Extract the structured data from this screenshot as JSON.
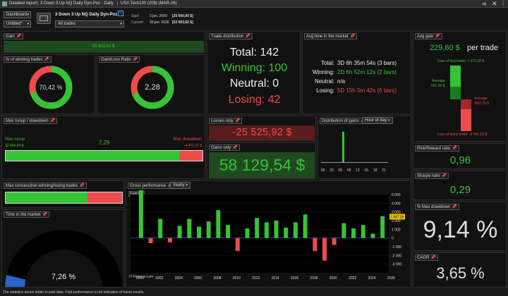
{
  "titlebar": {
    "tab1": "Detailed report",
    "tab2": "3 Down  3 Up NQ Daily Dyn-Poz - Daily",
    "tab3": "USA Tech100 (20$) (MAR-26)"
  },
  "toolbar": {
    "dashboard": "Dashboard",
    "untitled": "Untitled*",
    "strategy": "3 Down  3 Up NQ Daily Dyn-Poz",
    "filter": "All trades",
    "start_label": "Start:",
    "start_date": "3 jan. 2000",
    "start_value": "[20 000,00 $]",
    "current_label": "Current:",
    "current_date": "30 jan. 2026",
    "current_value": "[52 603,62 $]"
  },
  "gain": {
    "title": "Gain",
    "value": "32 603,62 $"
  },
  "winning_pct": {
    "title": "% of winning trades",
    "value": "70,42 %",
    "fraction": 0.7042
  },
  "gain_loss": {
    "title": "Gain/Loss Ratio",
    "value": "2,28",
    "fraction": 0.695
  },
  "trade_dist": {
    "title": "Trade distribution",
    "total": "Total: 142",
    "winning": "Winning: 100",
    "neutral": "Neutral: 0",
    "losing": "Losing: 42"
  },
  "avg_time": {
    "title": "Avg time in the market",
    "total_label": "Total:",
    "total": "3D 6h 35m 54s (3 bars)",
    "winning_label": "Winning:",
    "winning": "2D 6h 52m 12s (2 bars)",
    "neutral_label": "Neutral:",
    "neutral": "n/a",
    "losing_label": "Losing:",
    "losing": "5D 15h 5m 42s (6 bars)"
  },
  "avg_gain": {
    "title": "Avg gain",
    "value": "229,60 $",
    "per_trade": "per trade",
    "best_label": "Gain of best trade: 1 870,20 $",
    "average_label": "Average",
    "average_value": "581,30 $",
    "loss_avg_label": "Average",
    "loss_avg_value": "-807,76 $",
    "worst_label": "Loss of worst trade: -2 691,52 $"
  },
  "runup": {
    "title": "Max runup / drawdown",
    "runup_label": "Max runup",
    "runup_value": "32 606,04 $",
    "ratio": "7,29",
    "drawdown_label": "Max drawdown",
    "drawdown_value": "-4 471,12 $",
    "runup_fraction": 0.88
  },
  "losses_only": {
    "title": "Losses only",
    "value": "-25 525,92 $"
  },
  "gains_only": {
    "title": "Gains only",
    "value": "58 129,54 $"
  },
  "dist_gains": {
    "title": "Distribution of gains",
    "mode": "Hour of day",
    "ticks": [
      "00",
      "03",
      "06",
      "09",
      "12",
      "15",
      "18",
      "21"
    ]
  },
  "risk_reward": {
    "title": "Risk/Reward ratio",
    "value": "0,96"
  },
  "sharpe": {
    "title": "Sharpe ratio",
    "value": "0,29"
  },
  "max_dd_pct": {
    "title": "% Max drawdown",
    "value": "9,14 %"
  },
  "cagr": {
    "title": "CAGR",
    "value": "3,65 %"
  },
  "consec": {
    "title": "Max consecutive winning/losing trades",
    "win_fraction": 0.7
  },
  "time_market": {
    "title": "Time in the market",
    "value": "7,26 %",
    "fraction": 0.0726
  },
  "gross": {
    "title": "Gross performance",
    "mode": "Yearly",
    "gains_label": "Gains: $",
    "watermark": "IT-Finance.com",
    "current_marker": "2 447,26"
  },
  "chart_data": {
    "type": "bar",
    "title": "Gross performance",
    "ylabel": "Gains: $",
    "ylim": [
      -4000,
      5000
    ],
    "y_ticks": [
      "5 000",
      "4 000",
      "3 000",
      "2 000",
      "1 000",
      "0",
      "-1 000",
      "-2 000",
      "-3 000"
    ],
    "x_ticks": [
      "2000",
      "2002",
      "2004",
      "2006",
      "2008",
      "2010",
      "2012",
      "2014",
      "2016",
      "2018",
      "2020",
      "2022",
      "2024",
      "2026"
    ],
    "categories": [
      "2000",
      "2001",
      "2002",
      "2003",
      "2004",
      "2005",
      "2006",
      "2007",
      "2008",
      "2009",
      "2010",
      "2011",
      "2012",
      "2013",
      "2014",
      "2015",
      "2016",
      "2017",
      "2018",
      "2019",
      "2020",
      "2021",
      "2022",
      "2023",
      "2024",
      "2025"
    ],
    "values": [
      5800,
      -600,
      2200,
      -500,
      1400,
      2200,
      1300,
      1900,
      3200,
      1500,
      -1500,
      1100,
      2300,
      1800,
      2000,
      1200,
      1800,
      2700,
      -1500,
      -2600,
      -800,
      1700,
      1100,
      1500,
      500,
      2500
    ]
  },
  "footer": {
    "text": "The statistics above relate to past data. Past performance is not indicative of future results."
  },
  "colors": {
    "green": "#35c435",
    "red": "#ee4b4b",
    "bg": "#111111"
  }
}
